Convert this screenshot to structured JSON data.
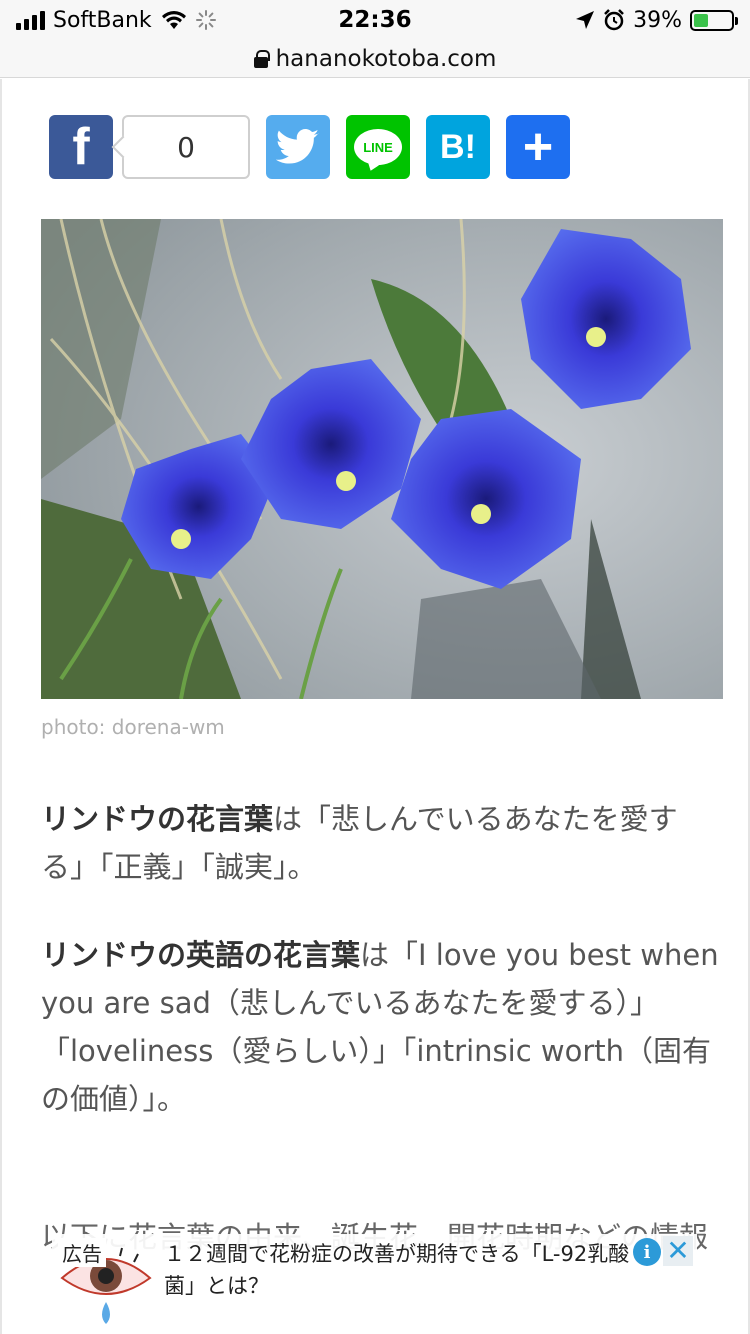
{
  "status_bar": {
    "carrier": "SoftBank",
    "time": "22:36",
    "battery": "39%",
    "battery_level": 0.39
  },
  "url_bar": {
    "domain": "hananokotoba.com"
  },
  "share": {
    "facebook_glyph": "f",
    "facebook_count": "0",
    "line_label": "LINE",
    "hatena_label": "B!",
    "more_label": "+"
  },
  "photo": {
    "credit": "photo: dorena-wm"
  },
  "article": {
    "p1_bold": "リンドウの花言葉",
    "p1_text": "は「悲しんでいるあなたを愛する」「正義」「誠実」。",
    "p2_bold": "リンドウの英語の花言葉",
    "p2_text": "は「I love you best when you are sad（悲しんでいるあなたを愛する）」「loveliness（愛らしい）」「intrinsic worth（固有の価値）」。",
    "p3_text": "以下に花言葉の由来、誕生花、開花時期などの情報"
  },
  "ad": {
    "label": "広告",
    "text": "１２週間で花粉症の改善が期待できる「L-92乳酸菌」とは？",
    "info_glyph": "i",
    "close_glyph": "✕"
  }
}
